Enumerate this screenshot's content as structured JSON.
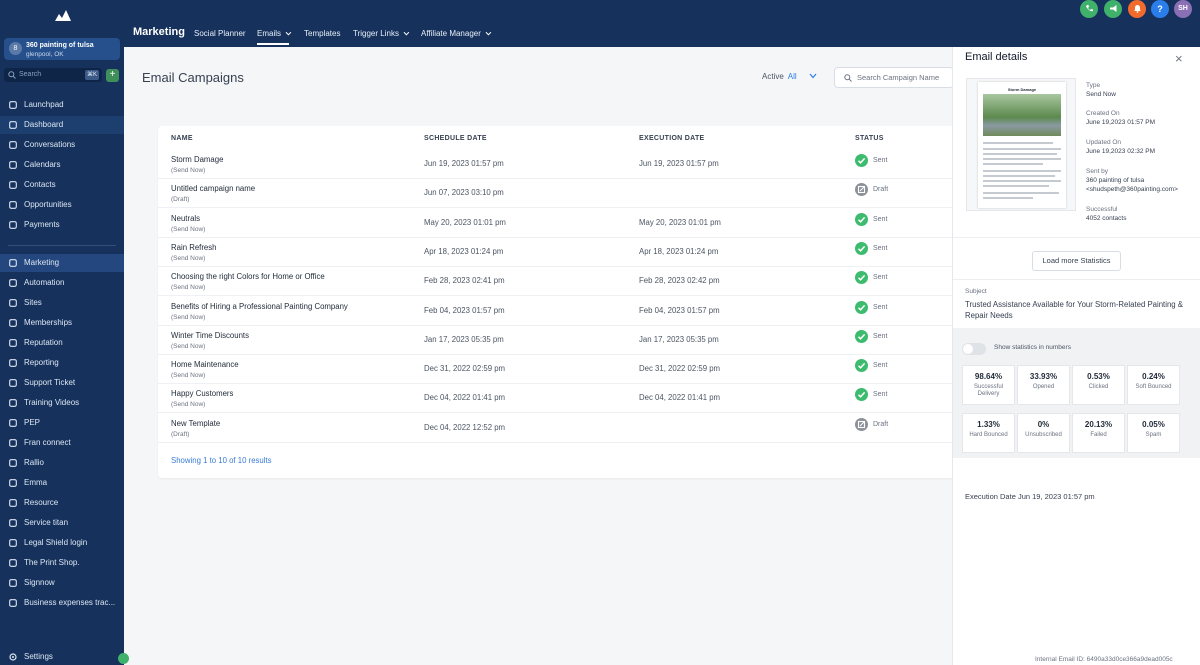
{
  "sidebar": {
    "location_name": "360 painting of tulsa",
    "location_city": "glenpool, OK",
    "location_initial": "8",
    "search_placeholder": "Search",
    "search_shortcut": "⌘K",
    "add_label": "+",
    "items": [
      {
        "label": "Launchpad",
        "icon": "rocket-icon"
      },
      {
        "label": "Dashboard",
        "icon": "dashboard-icon"
      },
      {
        "label": "Conversations",
        "icon": "chat-icon"
      },
      {
        "label": "Calendars",
        "icon": "calendar-icon"
      },
      {
        "label": "Contacts",
        "icon": "contacts-icon"
      },
      {
        "label": "Opportunities",
        "icon": "opportunities-icon"
      },
      {
        "label": "Payments",
        "icon": "payments-icon"
      },
      {
        "label": "Marketing",
        "icon": "send-icon"
      },
      {
        "label": "Automation",
        "icon": "automation-icon"
      },
      {
        "label": "Sites",
        "icon": "sites-icon"
      },
      {
        "label": "Memberships",
        "icon": "memberships-icon"
      },
      {
        "label": "Reputation",
        "icon": "reputation-icon"
      },
      {
        "label": "Reporting",
        "icon": "reporting-icon"
      },
      {
        "label": "Support Ticket",
        "icon": "ticket-icon"
      },
      {
        "label": "Training Videos",
        "icon": "video-icon"
      },
      {
        "label": "PEP",
        "icon": "link-icon"
      },
      {
        "label": "Fran connect",
        "icon": "link-icon"
      },
      {
        "label": "Rallio",
        "icon": "link-icon"
      },
      {
        "label": "Emma",
        "icon": "link-icon"
      },
      {
        "label": "Resource",
        "icon": "link-icon"
      },
      {
        "label": "Service titan",
        "icon": "link-icon"
      },
      {
        "label": "Legal Shield login",
        "icon": "link-icon"
      },
      {
        "label": "The Print Shop.",
        "icon": "link-icon"
      },
      {
        "label": "Signnow",
        "icon": "link-icon"
      },
      {
        "label": "Business expenses trac...",
        "icon": "link-icon"
      }
    ],
    "settings_label": "Settings"
  },
  "topbar": {
    "title": "Marketing",
    "nav": [
      "Social Planner",
      "Emails",
      "Templates",
      "Trigger Links",
      "Affiliate Manager"
    ],
    "avatar_initials": "SH",
    "help_label": "?"
  },
  "main": {
    "title": "Email Campaigns",
    "filter_label": "Active",
    "filter_value": "All",
    "search_placeholder": "Search Campaign Name",
    "columns": [
      "NAME",
      "SCHEDULE DATE",
      "EXECUTION DATE",
      "STATUS"
    ],
    "rows": [
      {
        "name": "Storm Damage",
        "sub": "(Send Now)",
        "schedule": "Jun 19, 2023 01:57 pm",
        "execution": "Jun 19, 2023 01:57 pm",
        "status": "Sent"
      },
      {
        "name": "Untitled campaign name",
        "sub": "(Draft)",
        "schedule": "Jun 07, 2023 03:10 pm",
        "execution": "",
        "status": "Draft"
      },
      {
        "name": "Neutrals",
        "sub": "(Send Now)",
        "schedule": "May 20, 2023 01:01 pm",
        "execution": "May 20, 2023 01:01 pm",
        "status": "Sent"
      },
      {
        "name": "Rain Refresh",
        "sub": "(Send Now)",
        "schedule": "Apr 18, 2023 01:24 pm",
        "execution": "Apr 18, 2023 01:24 pm",
        "status": "Sent"
      },
      {
        "name": "Choosing the right Colors for Home or Office",
        "sub": "(Send Now)",
        "schedule": "Feb 28, 2023 02:41 pm",
        "execution": "Feb 28, 2023 02:42 pm",
        "status": "Sent"
      },
      {
        "name": "Benefits of Hiring a Professional Painting Company",
        "sub": "(Send Now)",
        "schedule": "Feb 04, 2023 01:57 pm",
        "execution": "Feb 04, 2023 01:57 pm",
        "status": "Sent"
      },
      {
        "name": "Winter Time Discounts",
        "sub": "(Send Now)",
        "schedule": "Jan 17, 2023 05:35 pm",
        "execution": "Jan 17, 2023 05:35 pm",
        "status": "Sent"
      },
      {
        "name": "Home Maintenance",
        "sub": "(Send Now)",
        "schedule": "Dec 31, 2022 02:59 pm",
        "execution": "Dec 31, 2022 02:59 pm",
        "status": "Sent"
      },
      {
        "name": "Happy Customers",
        "sub": "(Send Now)",
        "schedule": "Dec 04, 2022 01:41 pm",
        "execution": "Dec 04, 2022 01:41 pm",
        "status": "Sent"
      },
      {
        "name": "New Template",
        "sub": "(Draft)",
        "schedule": "Dec 04, 2022 12:52 pm",
        "execution": "",
        "status": "Draft"
      }
    ],
    "showing": "Showing 1 to 10 of 10 results"
  },
  "panel": {
    "title": "Email details",
    "close_label": "×",
    "preview_title": "Storm Damage",
    "type_label": "Type",
    "type_value": "Send Now",
    "created_label": "Created On",
    "created_value": "June 19,2023 01:57 PM",
    "updated_label": "Updated On",
    "updated_value": "June 19,2023 02:32 PM",
    "sent_by_label": "Sent by",
    "sent_by_name": "360 painting of tulsa",
    "sent_by_email": "<shudspeth@360painting.com>",
    "successful_label": "Successful",
    "successful_value": "4052 contacts",
    "load_more": "Load more Statistics",
    "subject_label": "Subject",
    "subject_value": "Trusted Assistance Available for Your Storm-Related Painting & Repair Needs",
    "toggle_label": "Show statistics in numbers",
    "stats": [
      {
        "value": "98.64%",
        "label": "Successful Delivery"
      },
      {
        "value": "33.93%",
        "label": "Opened"
      },
      {
        "value": "0.53%",
        "label": "Clicked"
      },
      {
        "value": "0.24%",
        "label": "Soft Bounced"
      },
      {
        "value": "1.33%",
        "label": "Hard Bounced"
      },
      {
        "value": "0%",
        "label": "Unsubscribed"
      },
      {
        "value": "20.13%",
        "label": "Failed"
      },
      {
        "value": "0.05%",
        "label": "Spam"
      }
    ],
    "execution_date": "Execution Date Jun 19, 2023 01:57 pm",
    "internal_id": "Internal Email ID: 6490a33d0ce366a9dead005c"
  },
  "colors": {
    "sidebar": "#16325c",
    "accent": "#2b7de9",
    "sent": "#3dbb6e",
    "draft": "#8c9199"
  }
}
